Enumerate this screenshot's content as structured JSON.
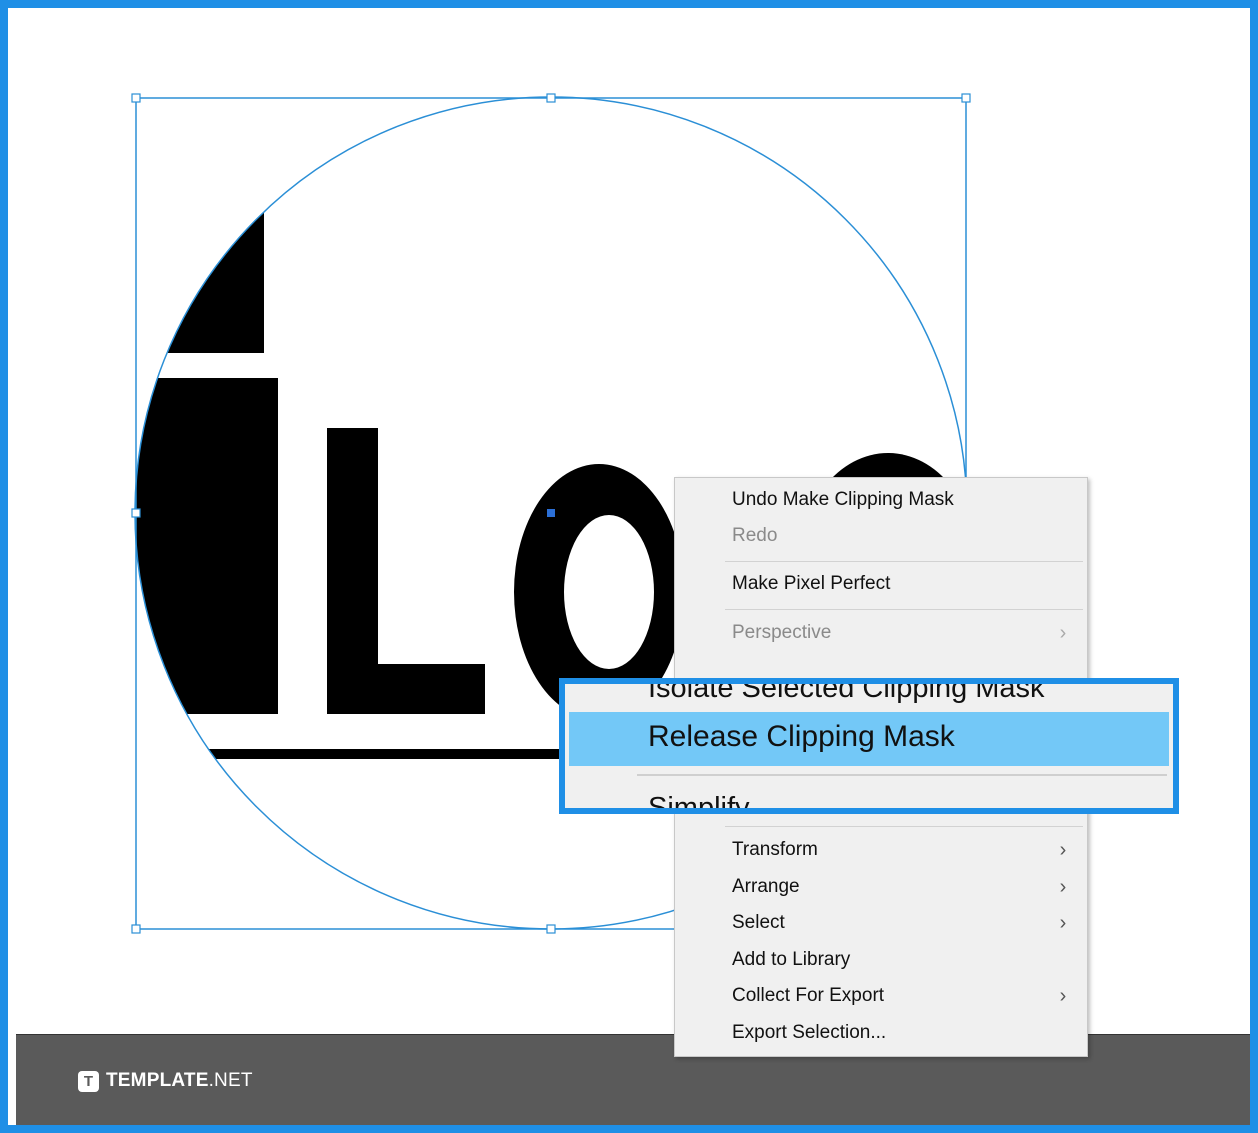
{
  "artwork": {
    "visible_text": "iLO"
  },
  "context_menu": {
    "items": [
      {
        "id": "undo",
        "label": "Undo Make Clipping Mask",
        "enabled": true,
        "submenu": false
      },
      {
        "id": "redo",
        "label": "Redo",
        "enabled": false,
        "submenu": false
      },
      {
        "id": "pixel_perfect",
        "label": "Make Pixel Perfect",
        "enabled": true,
        "submenu": false
      },
      {
        "id": "perspective",
        "label": "Perspective",
        "enabled": false,
        "submenu": true
      },
      {
        "id": "transform",
        "label": "Transform",
        "enabled": true,
        "submenu": true
      },
      {
        "id": "arrange",
        "label": "Arrange",
        "enabled": true,
        "submenu": true
      },
      {
        "id": "select",
        "label": "Select",
        "enabled": true,
        "submenu": true
      },
      {
        "id": "add_library",
        "label": "Add to Library",
        "enabled": true,
        "submenu": false
      },
      {
        "id": "collect_export",
        "label": "Collect For Export",
        "enabled": true,
        "submenu": true
      },
      {
        "id": "export_selection",
        "label": "Export Selection...",
        "enabled": true,
        "submenu": false
      }
    ],
    "submenu_glyph": "›"
  },
  "zoom_callout": {
    "above_partial": "Isolate Selected Clipping Mask",
    "highlighted": "Release Clipping Mask",
    "below_partial": "Simplify..."
  },
  "footer": {
    "logo_letter": "T",
    "brand_bold": "TEMPLATE",
    "brand_light": ".NET"
  },
  "colors": {
    "frame": "#1f8fe6",
    "selection": "#2b8fd6",
    "highlight": "#73c8f7",
    "menu_bg": "#f0f0f0",
    "footer": "#5a5a5a"
  }
}
